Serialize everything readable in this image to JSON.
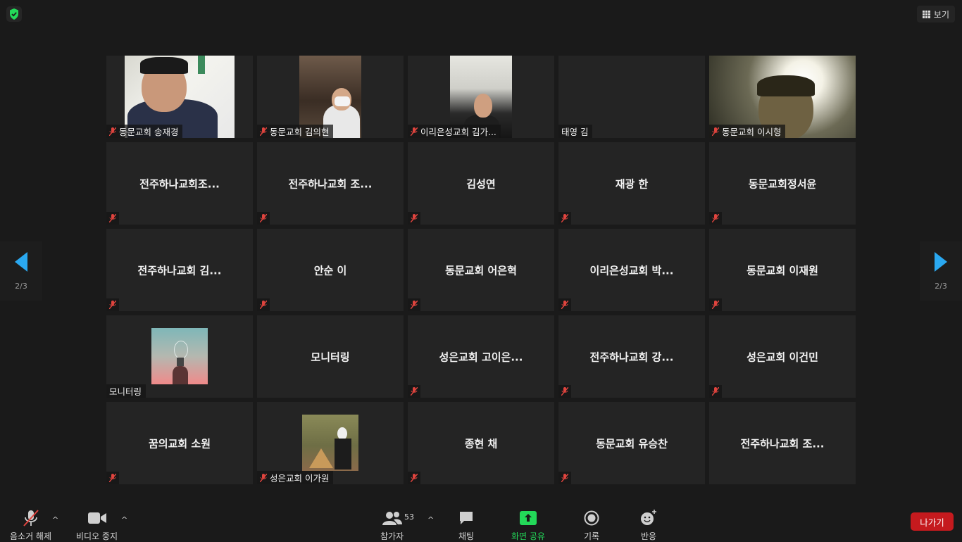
{
  "header": {
    "view_label": "보기"
  },
  "pagination": {
    "current": "2/3"
  },
  "tiles": [
    {
      "name": "동문교회 송재경",
      "video": true,
      "muted": true
    },
    {
      "name": "동문교회 김의현",
      "video": true,
      "muted": true
    },
    {
      "name": "이리은성교회 김가...",
      "video": true,
      "muted": true
    },
    {
      "name": "태영 김",
      "video": false,
      "muted": false,
      "center": ""
    },
    {
      "name": "동문교회 이시형",
      "video": true,
      "muted": true
    },
    {
      "center": "전주하나교회조...",
      "muted": true
    },
    {
      "center": "전주하나교회 조...",
      "muted": true
    },
    {
      "center": "김성연",
      "muted": true
    },
    {
      "center": "재광 한",
      "muted": true
    },
    {
      "center": "동문교회정서윤",
      "muted": true
    },
    {
      "center": "전주하나교회 김...",
      "muted": true
    },
    {
      "center": "안순 이",
      "muted": true
    },
    {
      "center": "동문교회 어은혁",
      "muted": true
    },
    {
      "center": "이리은성교회 박...",
      "muted": true
    },
    {
      "center": "동문교회 이재원",
      "muted": true
    },
    {
      "name": "모니터링",
      "avatar": true,
      "muted": false
    },
    {
      "center": "모니터링",
      "muted": false
    },
    {
      "center": "성은교회 고이은...",
      "muted": true
    },
    {
      "center": "전주하나교회 강...",
      "muted": true
    },
    {
      "center": "성은교회 이건민",
      "muted": true
    },
    {
      "center": "꿈의교회 소원",
      "muted": true
    },
    {
      "name": "성은교회 이가원",
      "avatar": true,
      "muted": true
    },
    {
      "center": "종현 채",
      "muted": true
    },
    {
      "center": "동문교회 유승찬",
      "muted": true
    },
    {
      "center": "전주하나교회 조...",
      "muted": false
    }
  ],
  "toolbar": {
    "unmute": "음소거 해제",
    "stop_video": "비디오 중지",
    "participants": "참가자",
    "participants_count": "53",
    "chat": "채팅",
    "share_screen": "화면 공유",
    "record": "기록",
    "reactions": "반응",
    "leave": "나가기"
  },
  "colors": {
    "accent_green": "#23d959",
    "leave_red": "#c51a1e",
    "arrow_blue": "#2aa8f0",
    "mute_red": "#e0443e"
  }
}
